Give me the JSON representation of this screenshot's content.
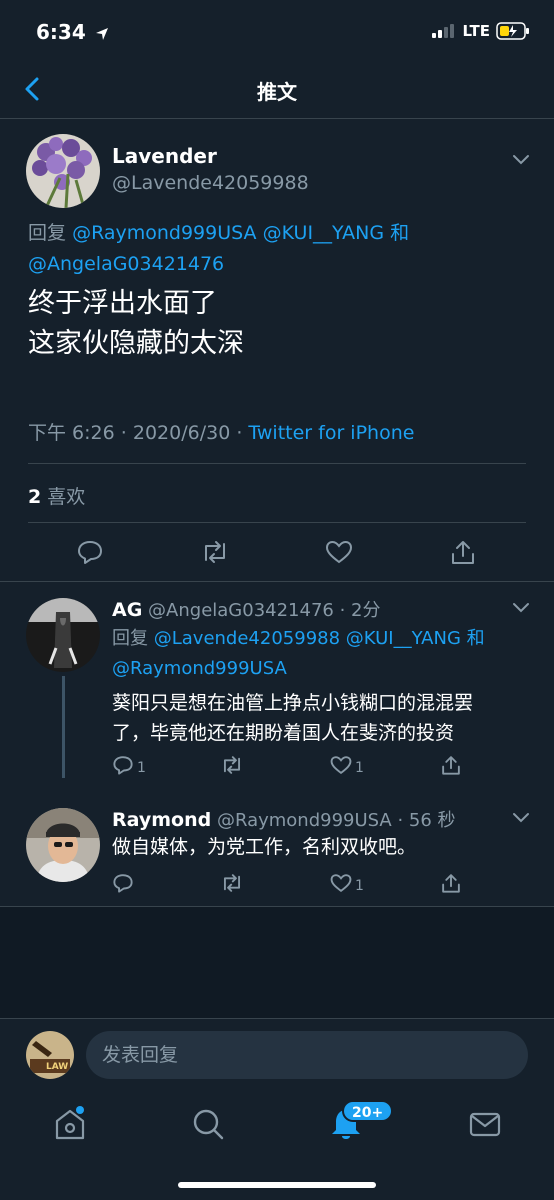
{
  "status_bar": {
    "time": "6:34",
    "carrier": "LTE"
  },
  "header": {
    "title": "推文"
  },
  "main_tweet": {
    "name": "Lavender",
    "handle": "@Lavende42059988",
    "reply_prefix": "回复",
    "reply_users_1": "@Raymond999USA @KUI__YANG",
    "reply_and": "和",
    "reply_users_2": "@AngelaG03421476",
    "text_line_1": "终于浮出水面了",
    "text_line_2": "这家伙隐藏的太深",
    "time": "下午 6:26",
    "date": "2020/6/30",
    "sep": "·",
    "source": "Twitter for iPhone",
    "likes_count": "2",
    "likes_label": "喜欢"
  },
  "replies": [
    {
      "name": "AG",
      "handle": "@AngelaG03421476",
      "age": "· 2分",
      "reply_prefix": "回复",
      "reply_users_1": "@Lavende42059988 @KUI__YANG",
      "reply_and": "和",
      "reply_users_2": "@Raymond999USA",
      "text_line_1": "葵阳只是想在油管上挣点小钱糊口的混混罢",
      "text_line_2": "了，毕竟他还在期盼着国人在斐济的投资",
      "reply_count": "1",
      "like_count": "1"
    },
    {
      "name": "Raymond",
      "handle": "@Raymond999USA",
      "age": "· 56 秒",
      "text_line_1": "做自媒体，为党工作，名利双收吧。",
      "like_count": "1"
    }
  ],
  "composer": {
    "placeholder": "发表回复"
  },
  "tabbar": {
    "notifications_badge": "20+"
  },
  "colors": {
    "background": "#15202b",
    "accent": "#1da1f2",
    "muted": "#8899a6",
    "divider": "#38444d"
  },
  "icons": [
    "back-arrow-icon",
    "chevron-down-icon",
    "reply-icon",
    "retweet-icon",
    "like-icon",
    "share-icon",
    "home-icon",
    "search-icon",
    "notifications-icon",
    "messages-icon"
  ]
}
